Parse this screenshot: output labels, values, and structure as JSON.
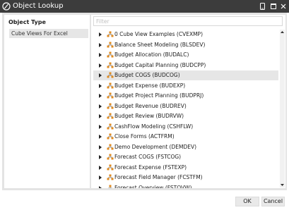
{
  "window": {
    "title": "Object Lookup",
    "icons": {
      "app": "onestream-logo-icon",
      "device": "phone-icon",
      "maximize": "maximize-icon",
      "close": "close-icon"
    }
  },
  "left_panel": {
    "header": "Object Type",
    "items": [
      {
        "label": "Cube Views For Excel",
        "selected": true
      }
    ]
  },
  "right_panel": {
    "filter": {
      "placeholder": "Filter",
      "value": ""
    },
    "tree": [
      {
        "label": "0 Cube View Examples (CVEXMP)"
      },
      {
        "label": "Balance Sheet Modeling (BLSDEV)"
      },
      {
        "label": "Budget Allocation (BUDALC)"
      },
      {
        "label": "Budget Capital Planning (BUDCPP)"
      },
      {
        "label": "Budget COGS (BUDCOG)",
        "selected": true
      },
      {
        "label": "Budget Expense (BUDEXP)"
      },
      {
        "label": "Budget Project Planning (BUDPRJ)"
      },
      {
        "label": "Budget Revenue (BUDREV)"
      },
      {
        "label": "Budget Review (BUDRVW)"
      },
      {
        "label": "CashFlow Modeling (CSHFLW)"
      },
      {
        "label": "Close Forms (ACTFRM)"
      },
      {
        "label": "Demo Development (DEMDEV)"
      },
      {
        "label": "Forecast COGS (FSTCOG)"
      },
      {
        "label": "Forecast Expense (FSTEXP)"
      },
      {
        "label": "Forecast Field Manager (FCSTFM)"
      },
      {
        "label": "Forecast Overview (FSTOVW)"
      }
    ],
    "expander_icon": "expand-arrow-icon",
    "node_icon": "cube-group-icon"
  },
  "footer": {
    "ok_label": "OK",
    "cancel_label": "Cancel"
  },
  "colors": {
    "titlebar": "#3c3c3c",
    "node_icon": "#e08a1e",
    "selection": "#e6e6e6"
  }
}
